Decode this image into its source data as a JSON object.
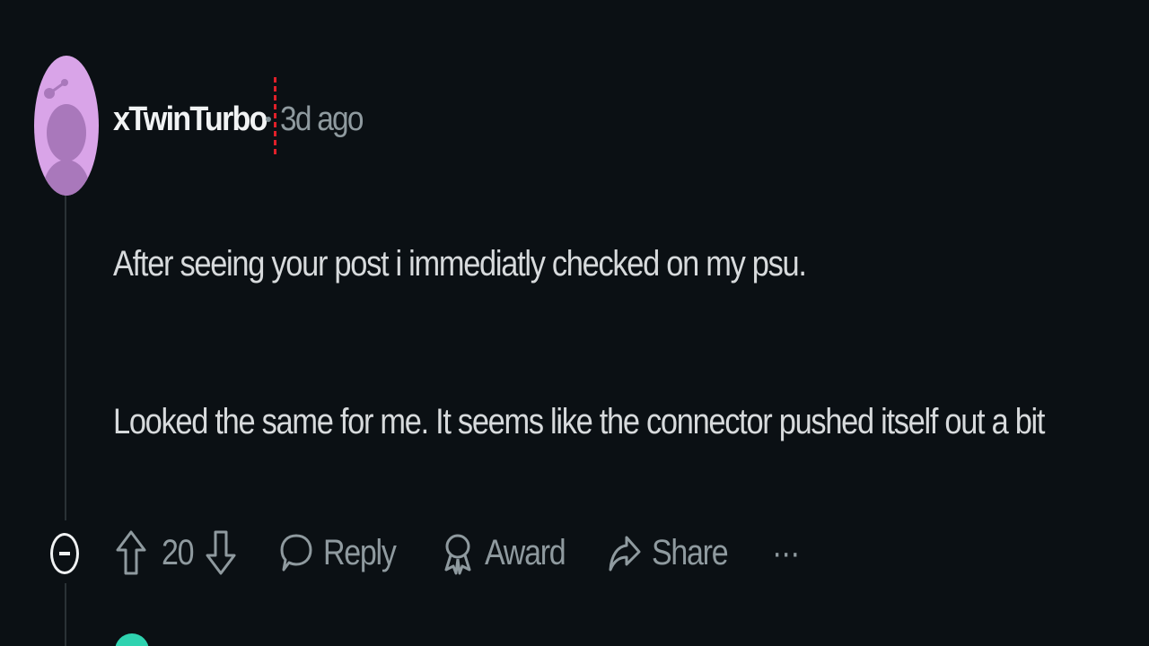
{
  "comment": {
    "username": "xTwinTurbo",
    "timestamp": "3d ago",
    "paragraphs": [
      "After seeing your post i immediatly checked on my psu.",
      "Looked the same for me. It seems like the connector pushed itself out a bit"
    ]
  },
  "actions": {
    "vote_count": "20",
    "reply_label": "Reply",
    "award_label": "Award",
    "share_label": "Share",
    "more_label": "···"
  },
  "icons": {
    "avatar": "reddit-snoo-avatar",
    "upvote": "arrow-up-icon",
    "downvote": "arrow-down-icon",
    "reply": "speech-bubble-icon",
    "award": "award-ribbon-icon",
    "share": "share-arrow-icon",
    "collapse": "collapse-minus-icon"
  },
  "colors": {
    "background": "#0b1014",
    "text": "#d7dadc",
    "muted": "#8f9a9f",
    "avatar_bg": "#d9a4e8",
    "next_avatar": "#2fd3b0"
  }
}
